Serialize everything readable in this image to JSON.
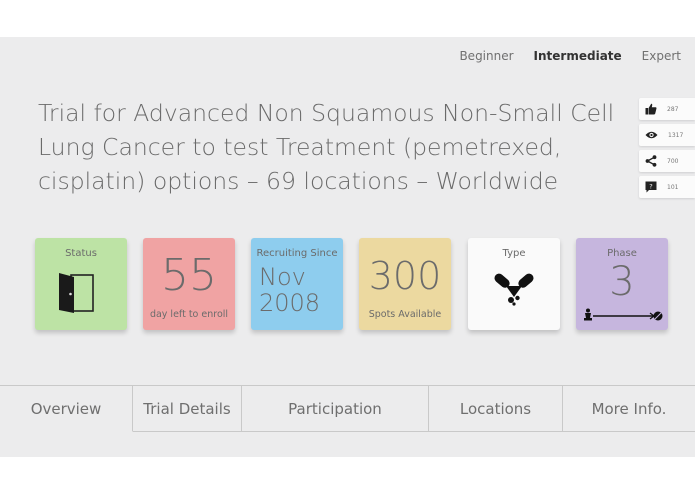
{
  "levels": [
    "Beginner",
    "Intermediate",
    "Expert"
  ],
  "active_level": "Intermediate",
  "title": "Trial for Advanced Non Squamous Non-Small Cell Lung Cancer to test Treatment (pemetrexed, cisplatin) options – 69 locations – Worldwide",
  "social": {
    "likes": "287",
    "views": "1317",
    "shares": "700",
    "comments": "101"
  },
  "cards": {
    "status": {
      "label": "Status",
      "icon": "door-icon",
      "color": "#bde3a5"
    },
    "days": {
      "value": "55",
      "caption": "day left to enroll",
      "color": "#f0a3a3"
    },
    "recruiting": {
      "label": "Recruiting Since",
      "month": "Nov",
      "year": "2008",
      "color": "#8ecdee"
    },
    "spots": {
      "value": "300",
      "caption": "Spots Available",
      "color": "#ecd9a0"
    },
    "type": {
      "label": "Type",
      "icon": "pill-icon",
      "color": "#fafafa"
    },
    "phase": {
      "label": "Phase",
      "value": "3",
      "icon": "phase-track-icon",
      "color": "#c6b6de"
    }
  },
  "tabs": [
    "Overview",
    "Trial Details",
    "Participation",
    "Locations",
    "More Info."
  ],
  "active_tab": "Overview"
}
